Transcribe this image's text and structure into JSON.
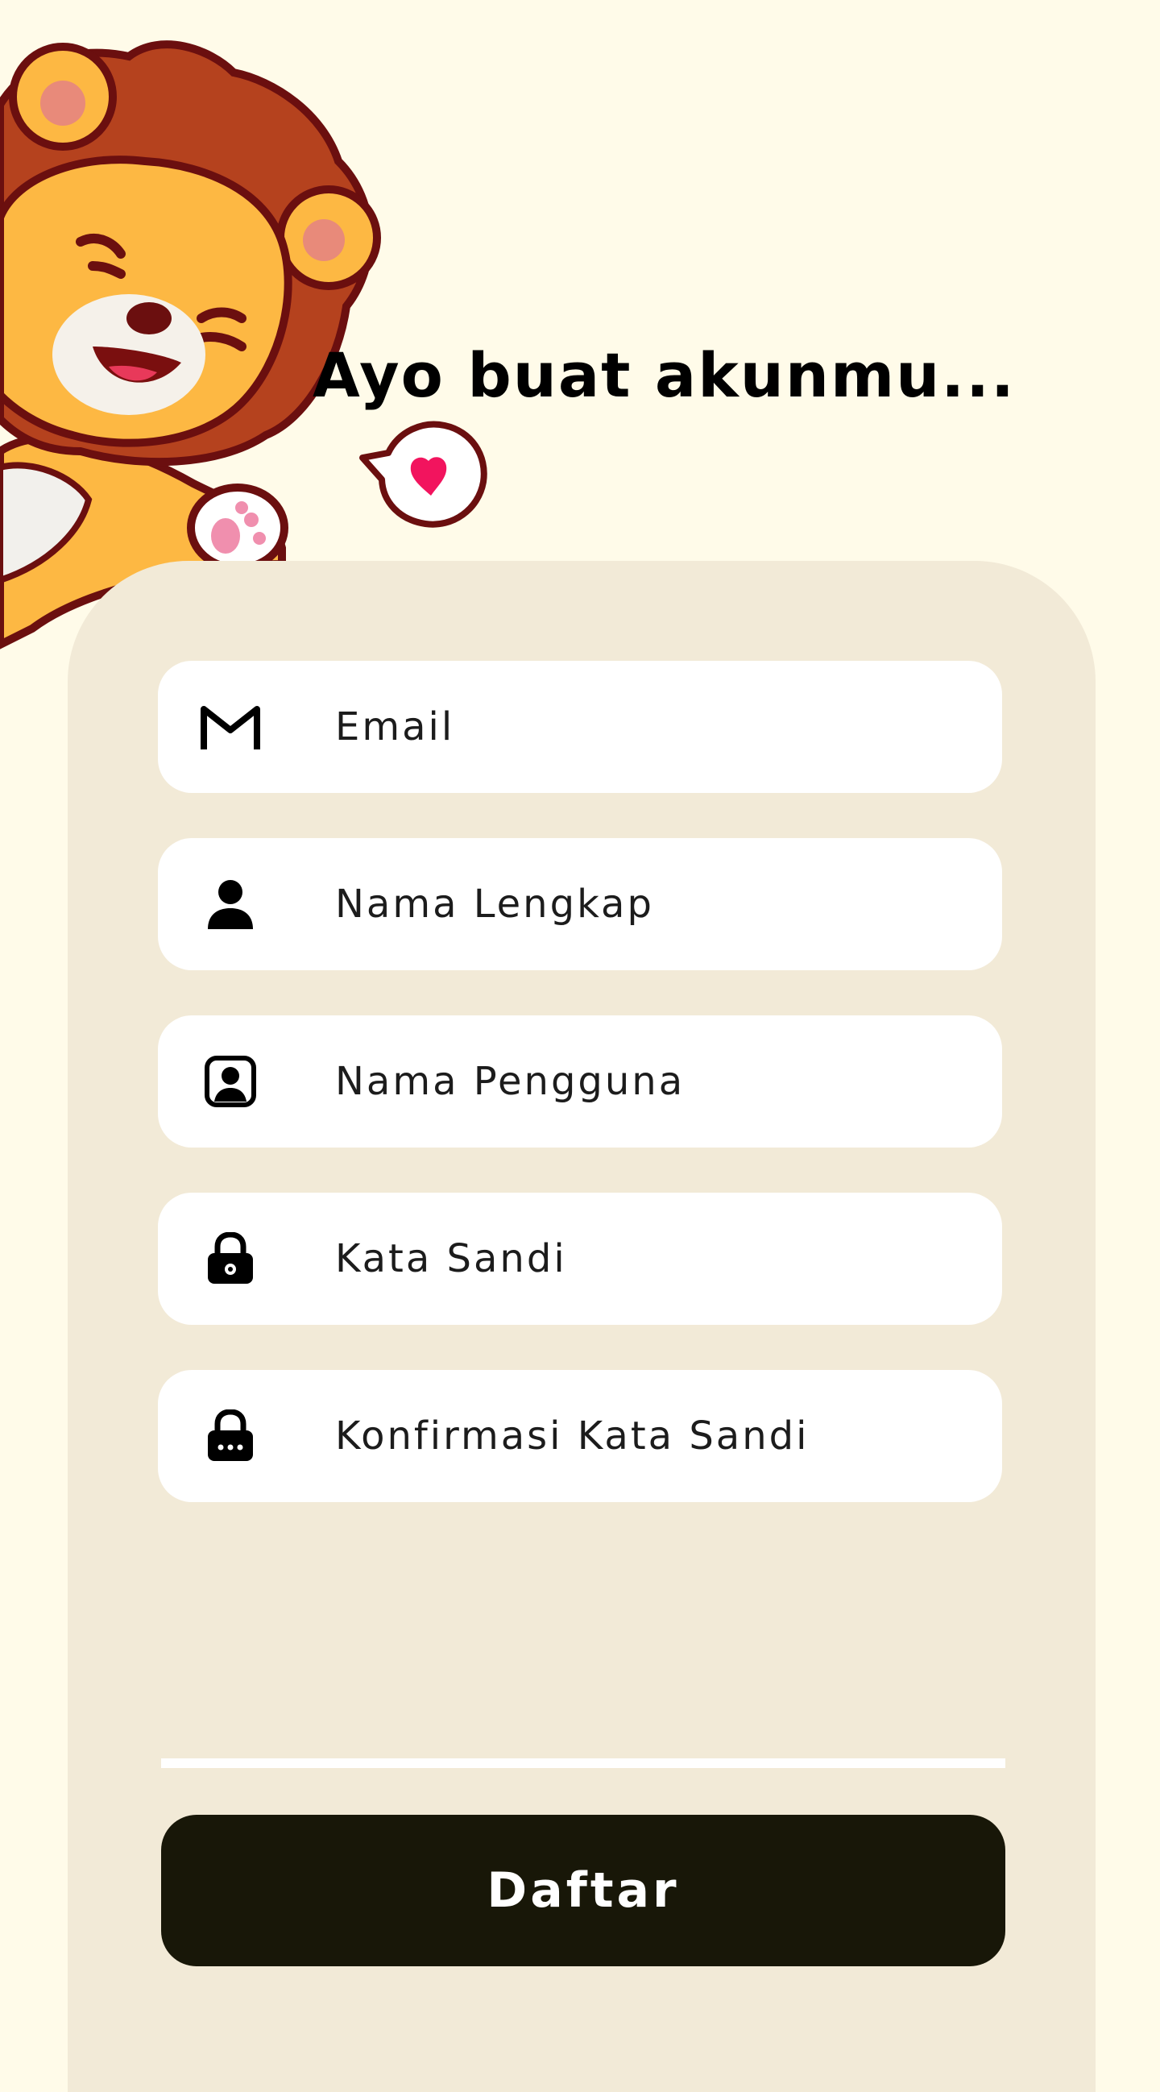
{
  "header": {
    "title": "Ayo buat akunmu..."
  },
  "form": {
    "fields": [
      {
        "icon": "gmail-icon",
        "placeholder": "Email"
      },
      {
        "icon": "person-icon",
        "placeholder": "Nama Lengkap"
      },
      {
        "icon": "account-box-icon",
        "placeholder": "Nama Pengguna"
      },
      {
        "icon": "lock-icon",
        "placeholder": "Kata Sandi"
      },
      {
        "icon": "lock-password-icon",
        "placeholder": "Konfirmasi Kata Sandi"
      }
    ],
    "submit_label": "Daftar"
  },
  "colors": {
    "background": "#FFFBE9",
    "card": "#F2EAD7",
    "field": "#FFFFFF",
    "button": "#181708",
    "button_text": "#FFFFFF",
    "heart": "#F2145E"
  }
}
